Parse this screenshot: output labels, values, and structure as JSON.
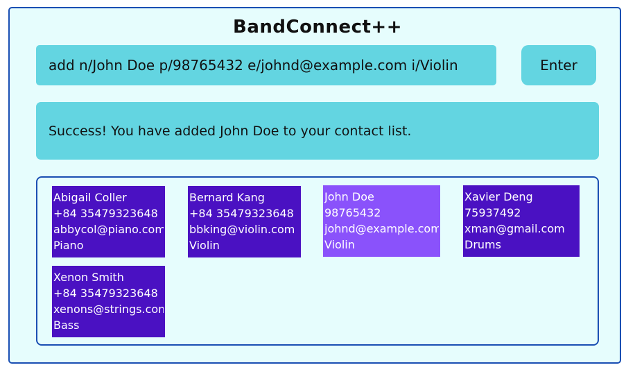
{
  "app": {
    "title": "BandConnect++"
  },
  "command": {
    "value": "add n/John Doe p/98765432 e/johnd@example.com i/Violin",
    "enter_label": "Enter"
  },
  "feedback": {
    "message": "Success! You have added John Doe to your contact list."
  },
  "contacts": [
    {
      "name": "Abigail Coller",
      "phone": "+84 35479323648",
      "email": "abbycol@piano.com",
      "instrument": "Piano"
    },
    {
      "name": "Bernard Kang",
      "phone": "+84 35479323648",
      "email": "bbking@violin.com",
      "instrument": "Violin"
    },
    {
      "name": "John Doe",
      "phone": "98765432",
      "email": "johnd@example.com",
      "instrument": "Violin",
      "selected": true
    },
    {
      "name": "Xavier Deng",
      "phone": "75937492",
      "email": "xman@gmail.com",
      "instrument": "Drums"
    },
    {
      "name": "Xenon Smith",
      "phone": "+84 35479323648",
      "email": "xenons@strings.com",
      "instrument": "Bass"
    }
  ]
}
